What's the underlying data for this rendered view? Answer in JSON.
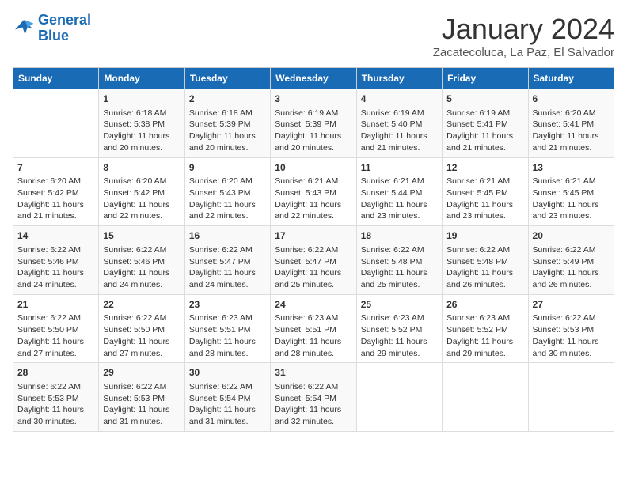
{
  "logo": {
    "line1": "General",
    "line2": "Blue"
  },
  "title": "January 2024",
  "subtitle": "Zacatecoluca, La Paz, El Salvador",
  "days_header": [
    "Sunday",
    "Monday",
    "Tuesday",
    "Wednesday",
    "Thursday",
    "Friday",
    "Saturday"
  ],
  "weeks": [
    [
      {
        "day": "",
        "content": ""
      },
      {
        "day": "1",
        "content": "Sunrise: 6:18 AM\nSunset: 5:38 PM\nDaylight: 11 hours and 20 minutes."
      },
      {
        "day": "2",
        "content": "Sunrise: 6:18 AM\nSunset: 5:39 PM\nDaylight: 11 hours and 20 minutes."
      },
      {
        "day": "3",
        "content": "Sunrise: 6:19 AM\nSunset: 5:39 PM\nDaylight: 11 hours and 20 minutes."
      },
      {
        "day": "4",
        "content": "Sunrise: 6:19 AM\nSunset: 5:40 PM\nDaylight: 11 hours and 21 minutes."
      },
      {
        "day": "5",
        "content": "Sunrise: 6:19 AM\nSunset: 5:41 PM\nDaylight: 11 hours and 21 minutes."
      },
      {
        "day": "6",
        "content": "Sunrise: 6:20 AM\nSunset: 5:41 PM\nDaylight: 11 hours and 21 minutes."
      }
    ],
    [
      {
        "day": "7",
        "content": "Sunrise: 6:20 AM\nSunset: 5:42 PM\nDaylight: 11 hours and 21 minutes."
      },
      {
        "day": "8",
        "content": "Sunrise: 6:20 AM\nSunset: 5:42 PM\nDaylight: 11 hours and 22 minutes."
      },
      {
        "day": "9",
        "content": "Sunrise: 6:20 AM\nSunset: 5:43 PM\nDaylight: 11 hours and 22 minutes."
      },
      {
        "day": "10",
        "content": "Sunrise: 6:21 AM\nSunset: 5:43 PM\nDaylight: 11 hours and 22 minutes."
      },
      {
        "day": "11",
        "content": "Sunrise: 6:21 AM\nSunset: 5:44 PM\nDaylight: 11 hours and 23 minutes."
      },
      {
        "day": "12",
        "content": "Sunrise: 6:21 AM\nSunset: 5:45 PM\nDaylight: 11 hours and 23 minutes."
      },
      {
        "day": "13",
        "content": "Sunrise: 6:21 AM\nSunset: 5:45 PM\nDaylight: 11 hours and 23 minutes."
      }
    ],
    [
      {
        "day": "14",
        "content": "Sunrise: 6:22 AM\nSunset: 5:46 PM\nDaylight: 11 hours and 24 minutes."
      },
      {
        "day": "15",
        "content": "Sunrise: 6:22 AM\nSunset: 5:46 PM\nDaylight: 11 hours and 24 minutes."
      },
      {
        "day": "16",
        "content": "Sunrise: 6:22 AM\nSunset: 5:47 PM\nDaylight: 11 hours and 24 minutes."
      },
      {
        "day": "17",
        "content": "Sunrise: 6:22 AM\nSunset: 5:47 PM\nDaylight: 11 hours and 25 minutes."
      },
      {
        "day": "18",
        "content": "Sunrise: 6:22 AM\nSunset: 5:48 PM\nDaylight: 11 hours and 25 minutes."
      },
      {
        "day": "19",
        "content": "Sunrise: 6:22 AM\nSunset: 5:48 PM\nDaylight: 11 hours and 26 minutes."
      },
      {
        "day": "20",
        "content": "Sunrise: 6:22 AM\nSunset: 5:49 PM\nDaylight: 11 hours and 26 minutes."
      }
    ],
    [
      {
        "day": "21",
        "content": "Sunrise: 6:22 AM\nSunset: 5:50 PM\nDaylight: 11 hours and 27 minutes."
      },
      {
        "day": "22",
        "content": "Sunrise: 6:22 AM\nSunset: 5:50 PM\nDaylight: 11 hours and 27 minutes."
      },
      {
        "day": "23",
        "content": "Sunrise: 6:23 AM\nSunset: 5:51 PM\nDaylight: 11 hours and 28 minutes."
      },
      {
        "day": "24",
        "content": "Sunrise: 6:23 AM\nSunset: 5:51 PM\nDaylight: 11 hours and 28 minutes."
      },
      {
        "day": "25",
        "content": "Sunrise: 6:23 AM\nSunset: 5:52 PM\nDaylight: 11 hours and 29 minutes."
      },
      {
        "day": "26",
        "content": "Sunrise: 6:23 AM\nSunset: 5:52 PM\nDaylight: 11 hours and 29 minutes."
      },
      {
        "day": "27",
        "content": "Sunrise: 6:22 AM\nSunset: 5:53 PM\nDaylight: 11 hours and 30 minutes."
      }
    ],
    [
      {
        "day": "28",
        "content": "Sunrise: 6:22 AM\nSunset: 5:53 PM\nDaylight: 11 hours and 30 minutes."
      },
      {
        "day": "29",
        "content": "Sunrise: 6:22 AM\nSunset: 5:53 PM\nDaylight: 11 hours and 31 minutes."
      },
      {
        "day": "30",
        "content": "Sunrise: 6:22 AM\nSunset: 5:54 PM\nDaylight: 11 hours and 31 minutes."
      },
      {
        "day": "31",
        "content": "Sunrise: 6:22 AM\nSunset: 5:54 PM\nDaylight: 11 hours and 32 minutes."
      },
      {
        "day": "",
        "content": ""
      },
      {
        "day": "",
        "content": ""
      },
      {
        "day": "",
        "content": ""
      }
    ]
  ]
}
